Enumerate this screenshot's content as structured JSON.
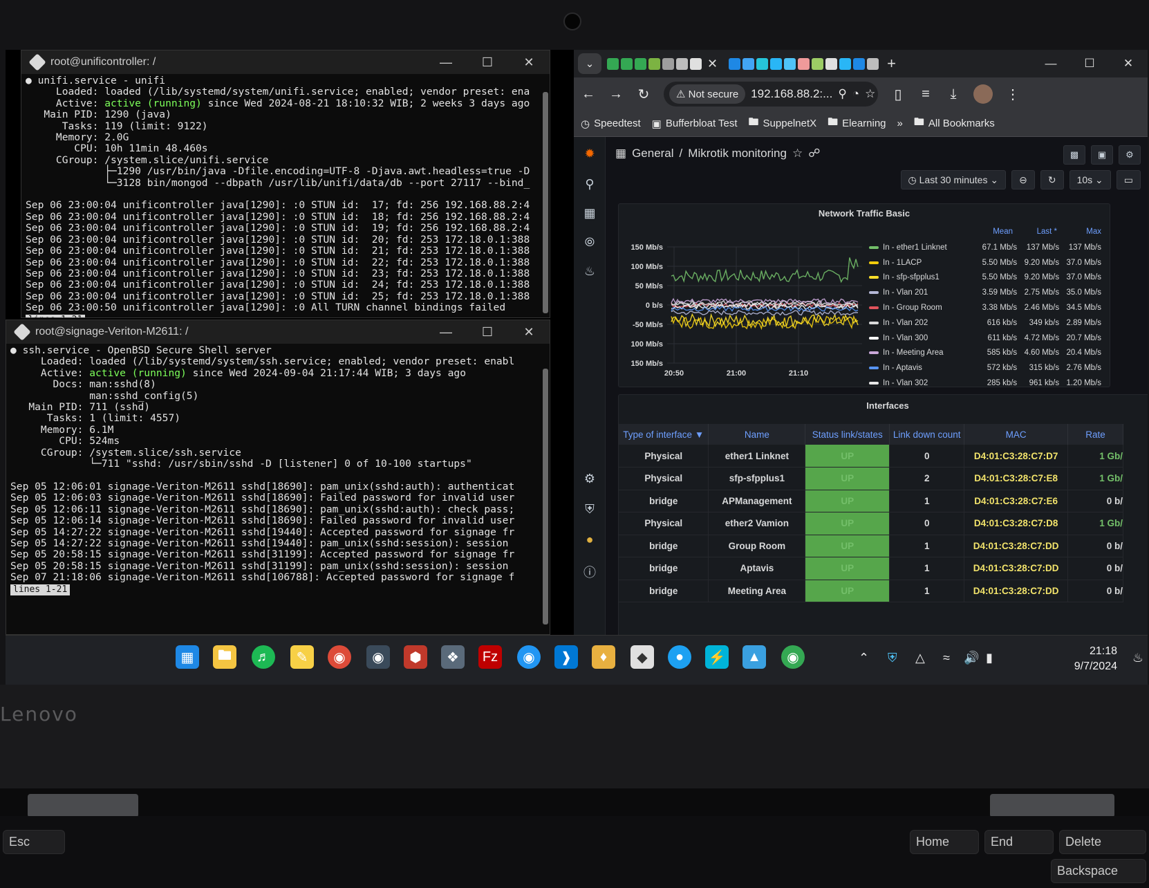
{
  "terminal1": {
    "title": "root@unificontroller: /",
    "lines": [
      {
        "text": "● unifi.service - unifi",
        "hl": null
      },
      {
        "text": "     Loaded: loaded (/lib/systemd/system/unifi.service; enabled; vendor preset: ena",
        "hl": null
      },
      {
        "pre": "     Active: ",
        "hl": "active (running)",
        "post": " since Wed 2024-08-21 18:10:32 WIB; 2 weeks 3 days ago"
      },
      {
        "text": "   Main PID: 1290 (java)",
        "hl": null
      },
      {
        "text": "      Tasks: 119 (limit: 9122)",
        "hl": null
      },
      {
        "text": "     Memory: 2.0G",
        "hl": null
      },
      {
        "text": "        CPU: 10h 11min 48.460s",
        "hl": null
      },
      {
        "text": "     CGroup: /system.slice/unifi.service",
        "hl": null
      },
      {
        "text": "             ├─1290 /usr/bin/java -Dfile.encoding=UTF-8 -Djava.awt.headless=true -D",
        "hl": null
      },
      {
        "text": "             └─3128 bin/mongod --dbpath /usr/lib/unifi/data/db --port 27117 --bind_",
        "hl": null
      },
      {
        "text": "",
        "hl": null
      },
      {
        "text": "Sep 06 23:00:04 unificontroller java[1290]: :0 STUN id:  17; fd: 256 192.168.88.2:4",
        "hl": null
      },
      {
        "text": "Sep 06 23:00:04 unificontroller java[1290]: :0 STUN id:  18; fd: 256 192.168.88.2:4",
        "hl": null
      },
      {
        "text": "Sep 06 23:00:04 unificontroller java[1290]: :0 STUN id:  19; fd: 256 192.168.88.2:4",
        "hl": null
      },
      {
        "text": "Sep 06 23:00:04 unificontroller java[1290]: :0 STUN id:  20; fd: 253 172.18.0.1:388",
        "hl": null
      },
      {
        "text": "Sep 06 23:00:04 unificontroller java[1290]: :0 STUN id:  21; fd: 253 172.18.0.1:388",
        "hl": null
      },
      {
        "text": "Sep 06 23:00:04 unificontroller java[1290]: :0 STUN id:  22; fd: 253 172.18.0.1:388",
        "hl": null
      },
      {
        "text": "Sep 06 23:00:04 unificontroller java[1290]: :0 STUN id:  23; fd: 253 172.18.0.1:388",
        "hl": null
      },
      {
        "text": "Sep 06 23:00:04 unificontroller java[1290]: :0 STUN id:  24; fd: 253 172.18.0.1:388",
        "hl": null
      },
      {
        "text": "Sep 06 23:00:04 unificontroller java[1290]: :0 STUN id:  25; fd: 253 172.18.0.1:388",
        "hl": null
      },
      {
        "text": "Sep 06 23:00:50 unificontroller java[1290]: :0 All TURN channel bindings failed",
        "hl": null
      }
    ],
    "pager": "lines 1-21"
  },
  "terminal2": {
    "title": "root@signage-Veriton-M2611: /",
    "lines": [
      {
        "text": "● ssh.service - OpenBSD Secure Shell server",
        "hl": null
      },
      {
        "text": "     Loaded: loaded (/lib/systemd/system/ssh.service; enabled; vendor preset: enabl",
        "hl": null
      },
      {
        "pre": "     Active: ",
        "hl": "active (running)",
        "post": " since Wed 2024-09-04 21:17:44 WIB; 3 days ago"
      },
      {
        "text": "       Docs: man:sshd(8)",
        "hl": null
      },
      {
        "text": "             man:sshd_config(5)",
        "hl": null
      },
      {
        "text": "   Main PID: 711 (sshd)",
        "hl": null
      },
      {
        "text": "      Tasks: 1 (limit: 4557)",
        "hl": null
      },
      {
        "text": "     Memory: 6.1M",
        "hl": null
      },
      {
        "text": "        CPU: 524ms",
        "hl": null
      },
      {
        "text": "     CGroup: /system.slice/ssh.service",
        "hl": null
      },
      {
        "text": "             └─711 \"sshd: /usr/sbin/sshd -D [listener] 0 of 10-100 startups\"",
        "hl": null
      },
      {
        "text": "",
        "hl": null
      },
      {
        "text": "Sep 05 12:06:01 signage-Veriton-M2611 sshd[18690]: pam_unix(sshd:auth): authenticat",
        "hl": null
      },
      {
        "text": "Sep 05 12:06:03 signage-Veriton-M2611 sshd[18690]: Failed password for invalid user",
        "hl": null
      },
      {
        "text": "Sep 05 12:06:11 signage-Veriton-M2611 sshd[18690]: pam_unix(sshd:auth): check pass;",
        "hl": null
      },
      {
        "text": "Sep 05 12:06:14 signage-Veriton-M2611 sshd[18690]: Failed password for invalid user",
        "hl": null
      },
      {
        "text": "Sep 05 14:27:22 signage-Veriton-M2611 sshd[19440]: Accepted password for signage fr",
        "hl": null
      },
      {
        "text": "Sep 05 14:27:22 signage-Veriton-M2611 sshd[19440]: pam_unix(sshd:session): session",
        "hl": null
      },
      {
        "text": "Sep 05 20:58:15 signage-Veriton-M2611 sshd[31199]: Accepted password for signage fr",
        "hl": null
      },
      {
        "text": "Sep 05 20:58:15 signage-Veriton-M2611 sshd[31199]: pam_unix(sshd:session): session",
        "hl": null
      },
      {
        "text": "Sep 07 21:18:06 signage-Veriton-M2611 sshd[106788]: Accepted password for signage f",
        "hl": null
      }
    ],
    "pager": "lines 1-21"
  },
  "browser": {
    "not_secure": "Not secure",
    "url": "192.168.88.2:...",
    "bookmarks": [
      "Speedtest",
      "Bufferbloat Test",
      "SuppelnetX",
      "Elearning"
    ],
    "more": "»",
    "all_bookmarks": "All Bookmarks"
  },
  "grafana": {
    "breadcrumb_home": "General",
    "breadcrumb_sep": "/",
    "breadcrumb_page": "Mikrotik monitoring",
    "time_range": "Last 30 minutes",
    "refresh": "10s"
  },
  "chart_data": {
    "type": "line",
    "title": "Network Traffic Basic",
    "y_tick_labels": [
      "150 Mb/s",
      "100 Mb/s",
      "50 Mb/s",
      "0 b/s",
      "-50 Mb/s",
      "100 Mb/s",
      "150 Mb/s"
    ],
    "y_ticks": [
      150,
      100,
      50,
      0,
      -50,
      -100,
      -150
    ],
    "x_ticks": [
      "20:50",
      "21:00",
      "21:10"
    ],
    "ylim": [
      -150,
      150
    ],
    "legend_headers": [
      "Mean",
      "Last *",
      "Max"
    ],
    "series": [
      {
        "name": "In - ether1 Linknet",
        "color": "#73bf69",
        "mean": "67.1 Mb/s",
        "last": "137 Mb/s",
        "max": "137 Mb/s",
        "level": 75
      },
      {
        "name": "In - 1LACP",
        "color": "#f2cc0c",
        "mean": "5.50 Mb/s",
        "last": "9.20 Mb/s",
        "max": "37.0 Mb/s",
        "level": -45
      },
      {
        "name": "In - sfp-sfpplus1",
        "color": "#fade2a",
        "mean": "5.50 Mb/s",
        "last": "9.20 Mb/s",
        "max": "37.0 Mb/s",
        "level": -40
      },
      {
        "name": "In - Vlan 201",
        "color": "#b4b7d6",
        "mean": "3.59 Mb/s",
        "last": "2.75 Mb/s",
        "max": "35.0 Mb/s",
        "level": -20
      },
      {
        "name": "In - Group Room",
        "color": "#e0535c",
        "mean": "3.38 Mb/s",
        "last": "2.46 Mb/s",
        "max": "34.5 Mb/s",
        "level": 0
      },
      {
        "name": "In - Vlan 202",
        "color": "#d8d9da",
        "mean": "616 kb/s",
        "last": "349 kb/s",
        "max": "2.89 Mb/s",
        "level": 5
      },
      {
        "name": "In - Vlan 300",
        "color": "#ffffff",
        "mean": "611 kb/s",
        "last": "4.72 Mb/s",
        "max": "20.7 Mb/s",
        "level": -5
      },
      {
        "name": "In - Meeting Area",
        "color": "#c9a7d9",
        "mean": "585 kb/s",
        "last": "4.60 Mb/s",
        "max": "20.4 Mb/s",
        "level": 10
      },
      {
        "name": "In - Aptavis",
        "color": "#5794f2",
        "mean": "572 kb/s",
        "last": "315 kb/s",
        "max": "2.76 Mb/s",
        "level": -10
      },
      {
        "name": "In - Vlan 302",
        "color": "#e6e6e6",
        "mean": "285 kb/s",
        "last": "961 kb/s",
        "max": "1.20 Mb/s",
        "level": 0
      }
    ]
  },
  "interfaces": {
    "title": "Interfaces",
    "headers": [
      "Type of interface",
      "Name",
      "Status link/states",
      "Link down count",
      "MAC",
      "Rate"
    ],
    "rows": [
      {
        "type": "Physical",
        "name": "ether1 Linknet",
        "status": "UP",
        "down": "0",
        "mac": "D4:01:C3:28:C7:D7",
        "rate": "1 Gb/"
      },
      {
        "type": "Physical",
        "name": "sfp-sfpplus1",
        "status": "UP",
        "down": "2",
        "mac": "D4:01:C3:28:C7:E8",
        "rate": "1 Gb/"
      },
      {
        "type": "bridge",
        "name": "APManagement",
        "status": "UP",
        "down": "1",
        "mac": "D4:01:C3:28:C7:E6",
        "rate": "0 b/"
      },
      {
        "type": "Physical",
        "name": "ether2 Vamion",
        "status": "UP",
        "down": "0",
        "mac": "D4:01:C3:28:C7:D8",
        "rate": "1 Gb/"
      },
      {
        "type": "bridge",
        "name": "Group Room",
        "status": "UP",
        "down": "1",
        "mac": "D4:01:C3:28:C7:DD",
        "rate": "0 b/"
      },
      {
        "type": "bridge",
        "name": "Aptavis",
        "status": "UP",
        "down": "1",
        "mac": "D4:01:C3:28:C7:DD",
        "rate": "0 b/"
      },
      {
        "type": "bridge",
        "name": "Meeting Area",
        "status": "UP",
        "down": "1",
        "mac": "D4:01:C3:28:C7:DD",
        "rate": "0 b/"
      }
    ]
  },
  "taskbar": {
    "time": "21:18",
    "date": "9/7/2024"
  },
  "laptop": {
    "brand": "Lenovo",
    "keys": [
      "Esc",
      "Home",
      "End",
      "Delete",
      "Backspace"
    ]
  },
  "colors": {
    "terminal_green": "#7dff5a",
    "grafana_bg": "#111217",
    "status_up": "#56a64b",
    "mac_yellow": "#f2e36b"
  }
}
